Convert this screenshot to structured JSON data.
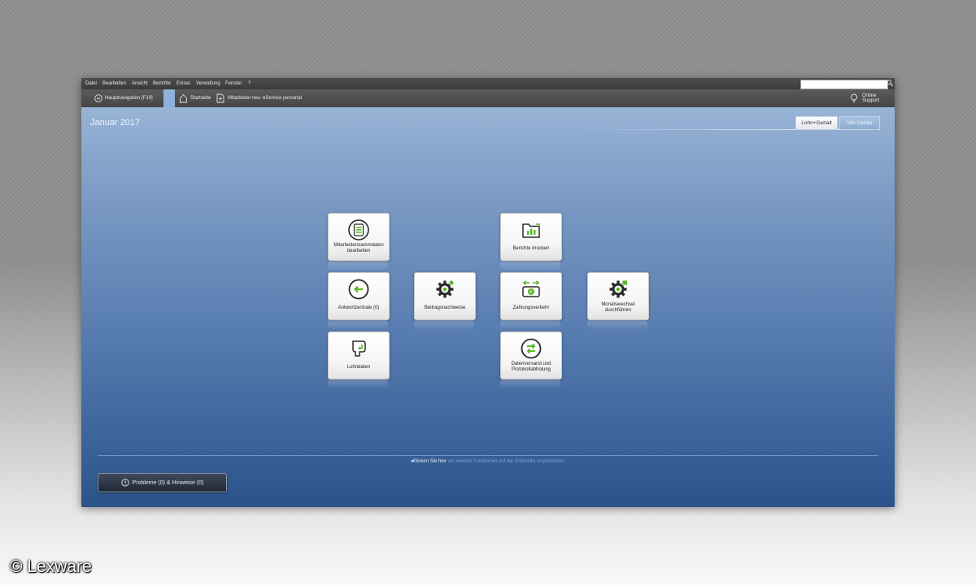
{
  "menu": [
    "Datei",
    "Bearbeiten",
    "Ansicht",
    "Berichte",
    "Extras",
    "Verwaltung",
    "Fenster",
    "?"
  ],
  "search": {
    "value": "",
    "placeholder": ""
  },
  "navbar": {
    "main_nav": "Hauptnavigation [F10]",
    "startseite": "Startseite",
    "mitarbeiter_neu": "Mitarbeiter neu",
    "eservice": "eService personal",
    "online_support": "Online Support"
  },
  "header": {
    "month": "Januar 2017",
    "tabs": [
      "Lohn+Gehalt",
      "Info Center"
    ]
  },
  "tiles": {
    "mitarbeiterstammdaten": "Mitarbeiterstammdaten bearbeiten",
    "berichte": "Berichte drucken",
    "antwortzentrale": "Antwortzentrale (0)",
    "beitragsnachweise": "Beitragsnachweise",
    "zahlungsverkehr": "Zahlungsverkehr",
    "monatswechsel": "Monatswechsel durchführen",
    "lohndaten": "Lohndaten",
    "datenversand": "Datenversand und Protokollabholung"
  },
  "footer": {
    "hint_link": "Klicken Sie hier",
    "hint_rest": "um weitere Funktionen auf die Startseite zu platzieren.",
    "problems": "Probleme (0) & Hinweise (0)"
  },
  "watermark": "© Lexware",
  "colors": {
    "accent_green": "#5cb82a",
    "content_top": "#98b4d6",
    "content_bottom": "#2b5289"
  }
}
